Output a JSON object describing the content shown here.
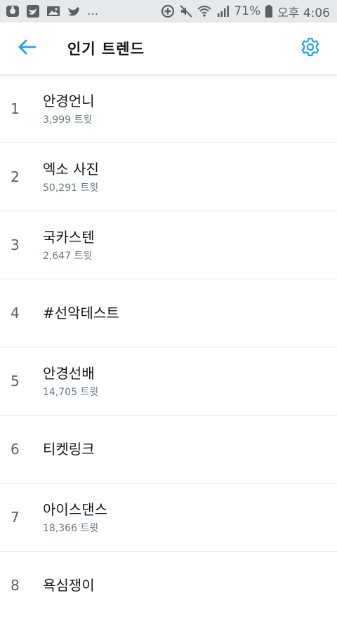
{
  "status_bar": {
    "icons_left": [
      "unknown-app-icon",
      "twitter-icon",
      "image-icon",
      "twitter-icon"
    ],
    "more": "...",
    "icons_right": [
      "data-saver-icon",
      "mute-icon",
      "wifi-icon",
      "signal-icon",
      "battery-icon"
    ],
    "battery": "71%",
    "time": "오후 4:06"
  },
  "header": {
    "title": "인기 트렌드",
    "back_icon": "arrow-left-icon",
    "settings_icon": "gear-icon"
  },
  "colors": {
    "accent": "#1da1f2",
    "status_bar_bg": "#e6e9ec",
    "divider": "#e1e8ed",
    "secondary_text": "#657786"
  },
  "trends": [
    {
      "rank": "1",
      "name": "안경언니",
      "count": "3,999 트윗"
    },
    {
      "rank": "2",
      "name": "엑소 사진",
      "count": "50,291 트윗"
    },
    {
      "rank": "3",
      "name": "국카스텐",
      "count": "2,647 트윗"
    },
    {
      "rank": "4",
      "name": "#선악테스트",
      "count": ""
    },
    {
      "rank": "5",
      "name": "안경선배",
      "count": "14,705 트윗"
    },
    {
      "rank": "6",
      "name": "티켓링크",
      "count": ""
    },
    {
      "rank": "7",
      "name": "아이스댄스",
      "count": "18,366 트윗"
    },
    {
      "rank": "8",
      "name": "욕심쟁이",
      "count": ""
    }
  ]
}
